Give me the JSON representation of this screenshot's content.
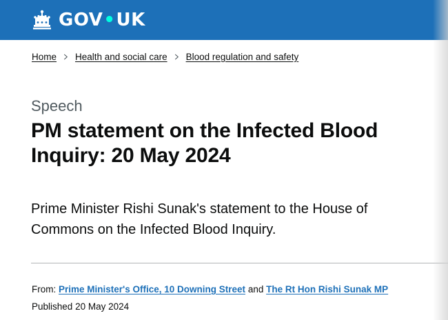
{
  "header": {
    "logo_text_left": "GOV",
    "logo_dot": "•",
    "logo_text_right": "UK",
    "background_color": "#1d70b8"
  },
  "breadcrumb": {
    "items": [
      {
        "label": "Home"
      },
      {
        "label": "Health and social care"
      },
      {
        "label": "Blood regulation and safety"
      }
    ]
  },
  "page": {
    "caption": "Speech",
    "title": "PM statement on the Infected Blood Inquiry: 20 May 2024",
    "lead": "Prime Minister Rishi Sunak's statement to the House of Commons on the Infected Blood Inquiry."
  },
  "metadata": {
    "from_label": "From:",
    "from_org_1": "Prime Minister's Office, 10 Downing Street",
    "and_text": "and",
    "from_org_2": "The Rt Hon Rishi Sunak MP",
    "published_label": "Published",
    "published_date": "20 May 2024"
  },
  "colors": {
    "link": "#1d70b8",
    "text": "#0b0c0c",
    "secondary_text": "#505a5f",
    "divider": "#b1b4b6"
  }
}
